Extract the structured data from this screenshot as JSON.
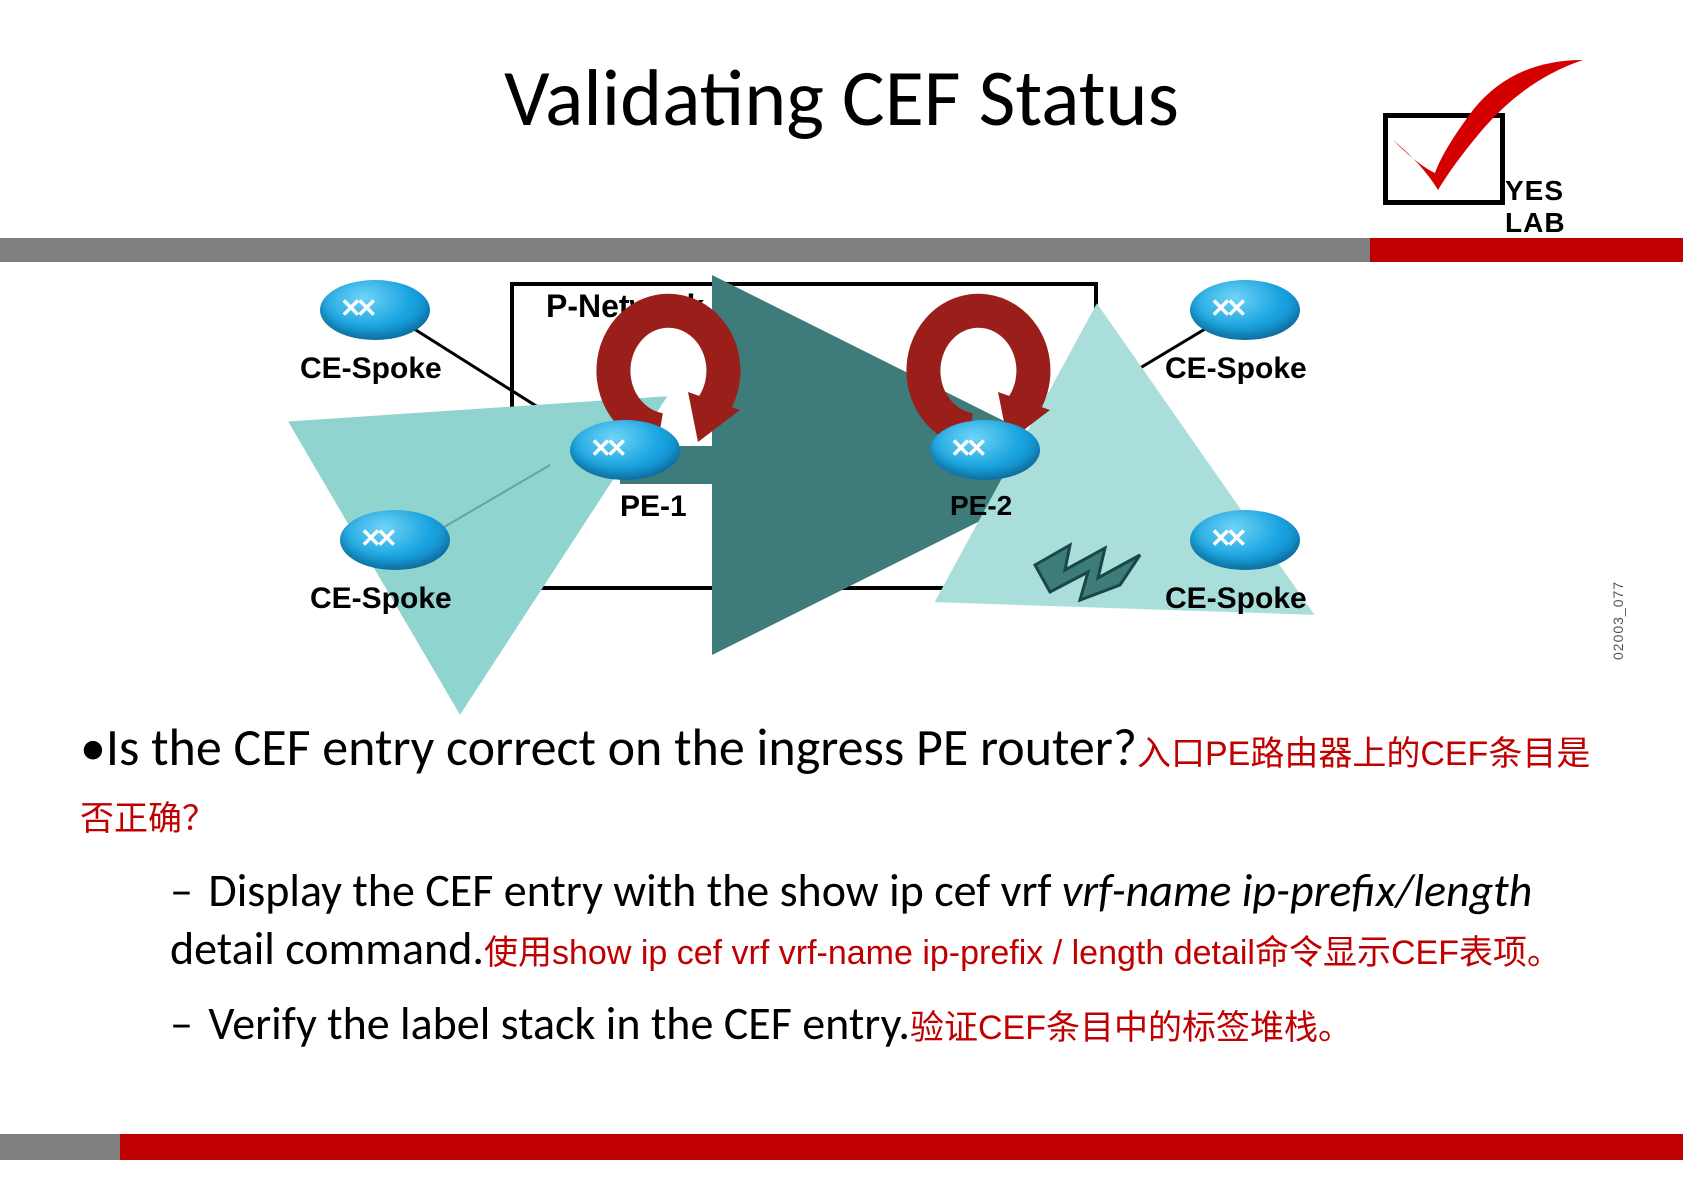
{
  "title": "Validating CEF Status",
  "logo_text": "YES LAB",
  "diagram": {
    "pnetwork": "P-Network",
    "labels": {
      "ce_tl": "CE-Spoke",
      "ce_bl": "CE-Spoke",
      "ce_tr": "CE-Spoke",
      "ce_br": "CE-Spoke",
      "pe1": "PE-1",
      "pe2": "PE-2"
    },
    "watermark": "02003_077"
  },
  "bullets": {
    "q_en": "Is the CEF entry correct on the ingress PE router?",
    "q_zh": "入口PE路由器上的CEF条目是否正确？",
    "s1_en_a": "Display the CEF entry with the show ip cef vrf ",
    "s1_en_b": "vrf-name ip-prefix/length",
    "s1_en_c": " detail  command.",
    "s1_zh": "使用show ip cef vrf vrf-name ip-prefix / length detail命令显示CEF表项。",
    "s2_en": "Verify the label stack in the CEF entry.",
    "s2_zh": "验证CEF条目中的标签堆栈。"
  }
}
